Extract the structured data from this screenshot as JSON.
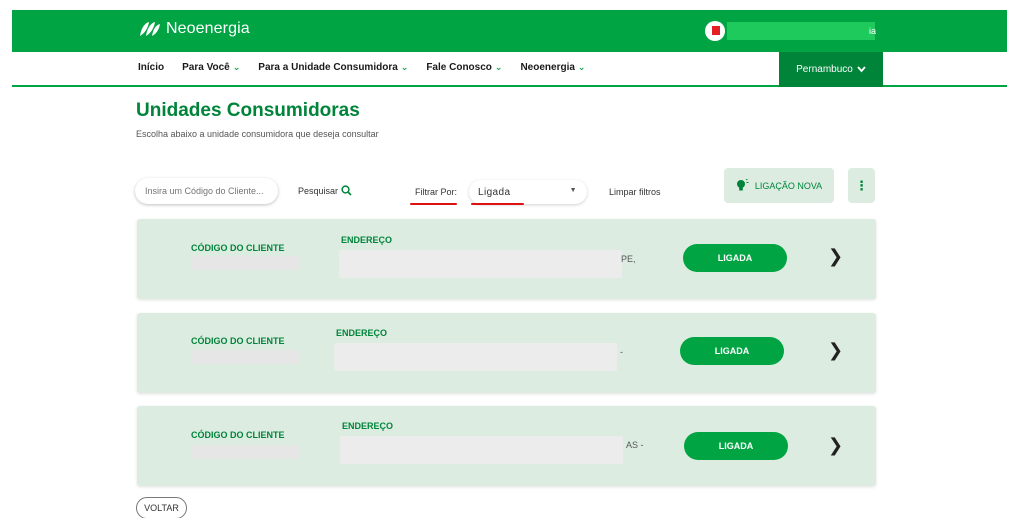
{
  "header": {
    "brand": "Neoenergia",
    "user_name_tail": "ia"
  },
  "nav": {
    "items": [
      {
        "label": "Início",
        "has_dropdown": false
      },
      {
        "label": "Para Você",
        "has_dropdown": true
      },
      {
        "label": "Para a Unidade Consumidora",
        "has_dropdown": true
      },
      {
        "label": "Fale Conosco",
        "has_dropdown": true
      },
      {
        "label": "Neoenergia",
        "has_dropdown": true
      }
    ],
    "region": "Pernambuco"
  },
  "page": {
    "title": "Unidades Consumidoras",
    "subtitle": "Escolha abaixo a unidade consumidora que deseja consultar"
  },
  "toolbar": {
    "search_placeholder": "Insira um Código do Cliente...",
    "search_label": "Pesquisar",
    "filter_label": "Filtrar Por:",
    "filter_value": "Ligada",
    "clear_filters": "Limpar filtros",
    "new_connection": "LIGAÇÃO NOVA"
  },
  "units": [
    {
      "code_label": "CÓDIGO DO CLIENTE",
      "address_label": "ENDEREÇO",
      "address_tail": "PE,",
      "status": "LIGADA"
    },
    {
      "code_label": "CÓDIGO DO CLIENTE",
      "address_label": "ENDEREÇO",
      "address_tail": "-",
      "status": "LIGADA"
    },
    {
      "code_label": "CÓDIGO DO CLIENTE",
      "address_label": "ENDEREÇO",
      "address_tail": "AS -",
      "status": "LIGADA"
    }
  ],
  "footer": {
    "back": "VOLTAR"
  },
  "colors": {
    "brand_green": "#00a443",
    "dark_green": "#00843a",
    "card_bg": "#dcece1",
    "annotation_red": "#dd1111"
  },
  "icons": {
    "logo": "leaves-logo-icon",
    "search": "magnifier-icon",
    "new_connection": "lightbulb-icon",
    "more": "vertical-dots-icon",
    "row_arrow": "chevron-right-icon"
  }
}
